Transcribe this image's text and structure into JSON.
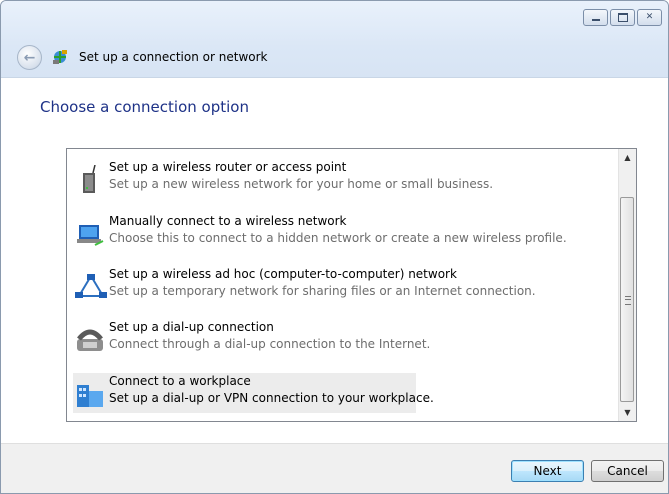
{
  "window": {
    "title": "Set up a connection or network",
    "controls": {
      "minimize": "▭",
      "restore": "⧉",
      "close": "✕"
    }
  },
  "main": {
    "heading": "Choose a connection option",
    "options": [
      {
        "title": "Set up a wireless router or access point",
        "desc": "Set up a new wireless network for your home or small business.",
        "icon": "router-icon"
      },
      {
        "title": "Manually connect to a wireless network",
        "desc": "Choose this to connect to a hidden network or create a new wireless profile.",
        "icon": "wireless-network-icon"
      },
      {
        "title": "Set up a wireless ad hoc (computer-to-computer) network",
        "desc": "Set up a temporary network for sharing files or an Internet connection.",
        "icon": "adhoc-network-icon"
      },
      {
        "title": "Set up a dial-up connection",
        "desc": "Connect through a dial-up connection to the Internet.",
        "icon": "dialup-phone-icon"
      },
      {
        "title": "Connect to a workplace",
        "desc": "Set up a dial-up or VPN connection to your workplace.",
        "icon": "workplace-icon",
        "selected": true
      }
    ]
  },
  "footer": {
    "next_label": "Next",
    "cancel_label": "Cancel"
  },
  "colors": {
    "heading": "#1e3287",
    "selected_row": "#ececec",
    "default_button": "#3c7fb1"
  }
}
